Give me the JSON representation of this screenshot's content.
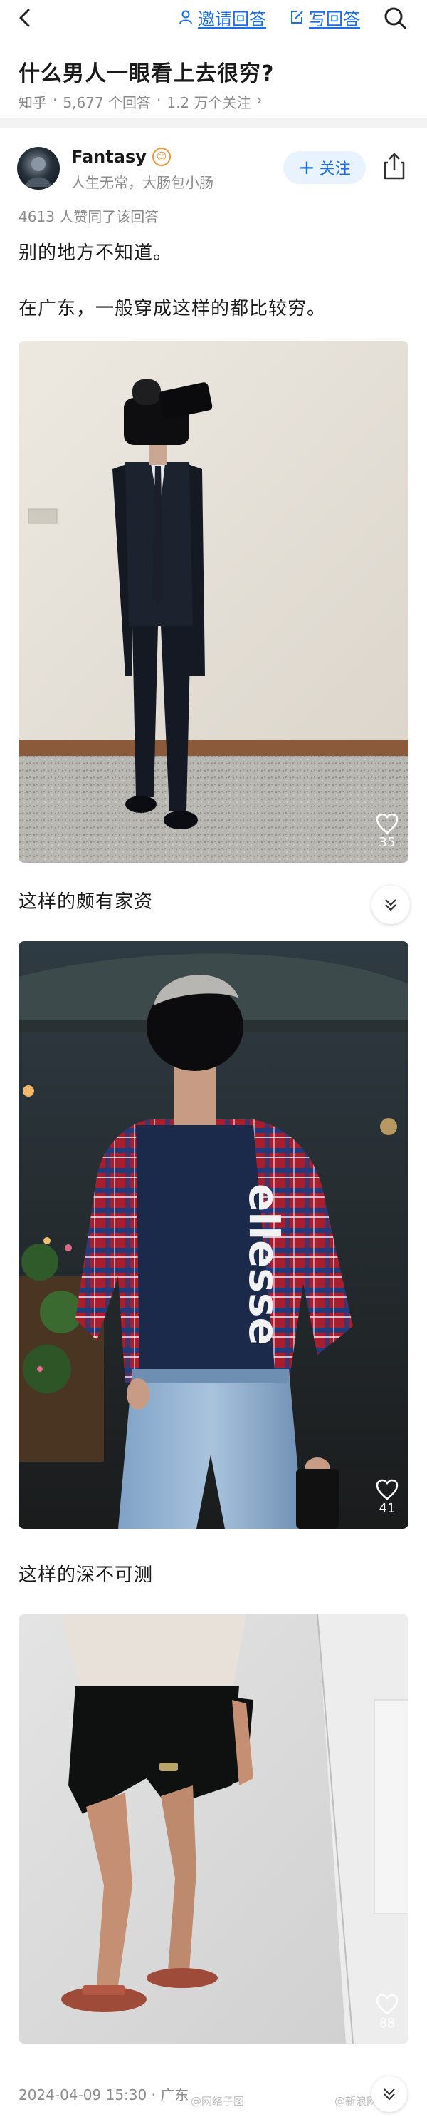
{
  "nav": {
    "invite_label": "邀请回答",
    "write_label": "写回答",
    "accent": "#1a6fe8"
  },
  "question": {
    "title": "什么男人一眼看上去很穷?",
    "source": "知乎",
    "answers": "5,677 个回答",
    "followers": "1.2 万个关注",
    "chevron": "›"
  },
  "author": {
    "name": "Fantasy",
    "bio": "人生无常，大肠包小肠",
    "follow_label": "关注",
    "follow_plus": "+",
    "badge_icon": "badge-icon"
  },
  "answer": {
    "upvotes": "4613 人赞同了该回答",
    "p1": "别的地方不知道。",
    "p2": "在广东，一般穿成这样的都比较穷。",
    "photos": [
      {
        "likes": "35"
      },
      {
        "likes": "41"
      },
      {
        "likes": "88"
      }
    ],
    "brand_text": "ellesse",
    "captions": [
      "这样的颇有家资",
      "这样的深不可测"
    ],
    "date": "2024-04-09 15:30 · 广东"
  },
  "watermarks": [
    "@网络子图",
    "@新浪网"
  ]
}
